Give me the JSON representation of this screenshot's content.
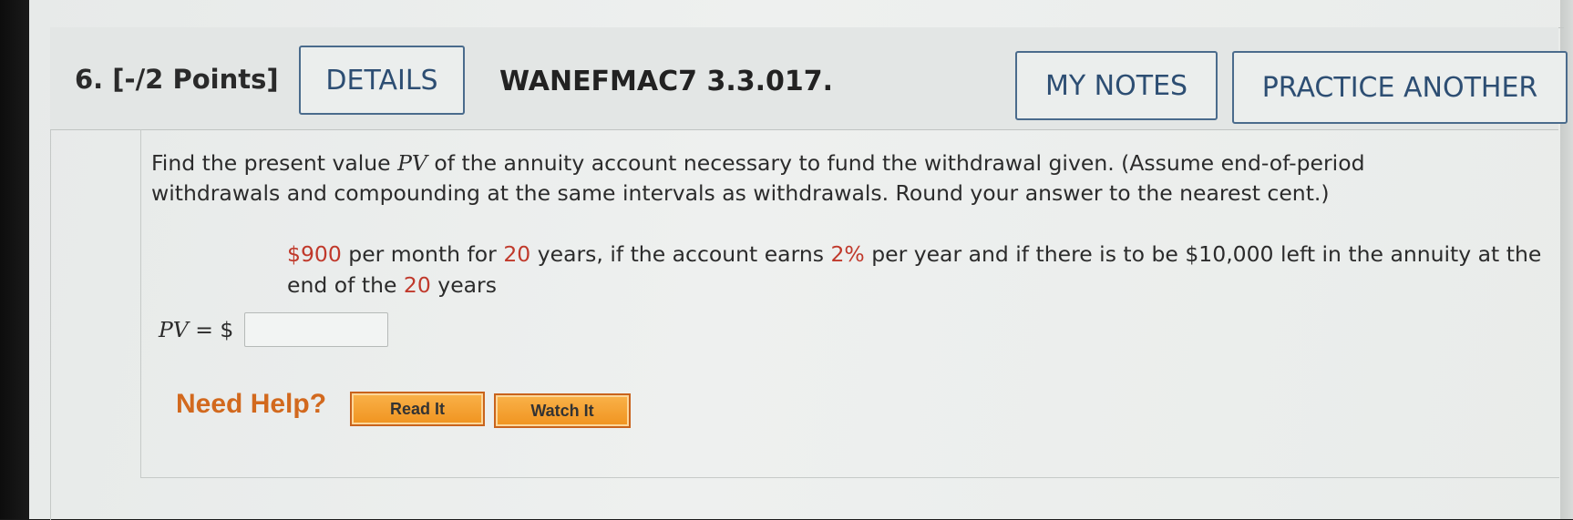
{
  "question": {
    "number_points": "6.  [-/2 Points]",
    "course_code": "WANEFMAC7 3.3.017."
  },
  "header_buttons": {
    "details": "DETAILS",
    "my_notes": "MY NOTES",
    "practice_another": "PRACTICE ANOTHER"
  },
  "prompt": {
    "before_pv": "Find the present value ",
    "pv": "PV",
    "after_pv": " of the annuity account necessary to fund the withdrawal given. (Assume end-of-period withdrawals and compounding at the same intervals as withdrawals. Round your answer to the nearest cent.)"
  },
  "detail": {
    "amount": "$900",
    "t1": " per month for ",
    "years": "20",
    "t2": " years, if the account earns ",
    "rate": "2%",
    "t3": " per year and if there is to be $10,000 left in the annuity at the end of the ",
    "years2": "20",
    "t4": " years"
  },
  "answer": {
    "pv_label": "PV",
    "equals_dollar": " = $",
    "value": ""
  },
  "help": {
    "label": "Need Help?",
    "read_it": "Read It",
    "watch_it": "Watch It"
  },
  "colors": {
    "highlight": "#c0392b",
    "button_border": "#4a6b8c",
    "button_text": "#2d4e73",
    "help_orange": "#d2691e"
  }
}
